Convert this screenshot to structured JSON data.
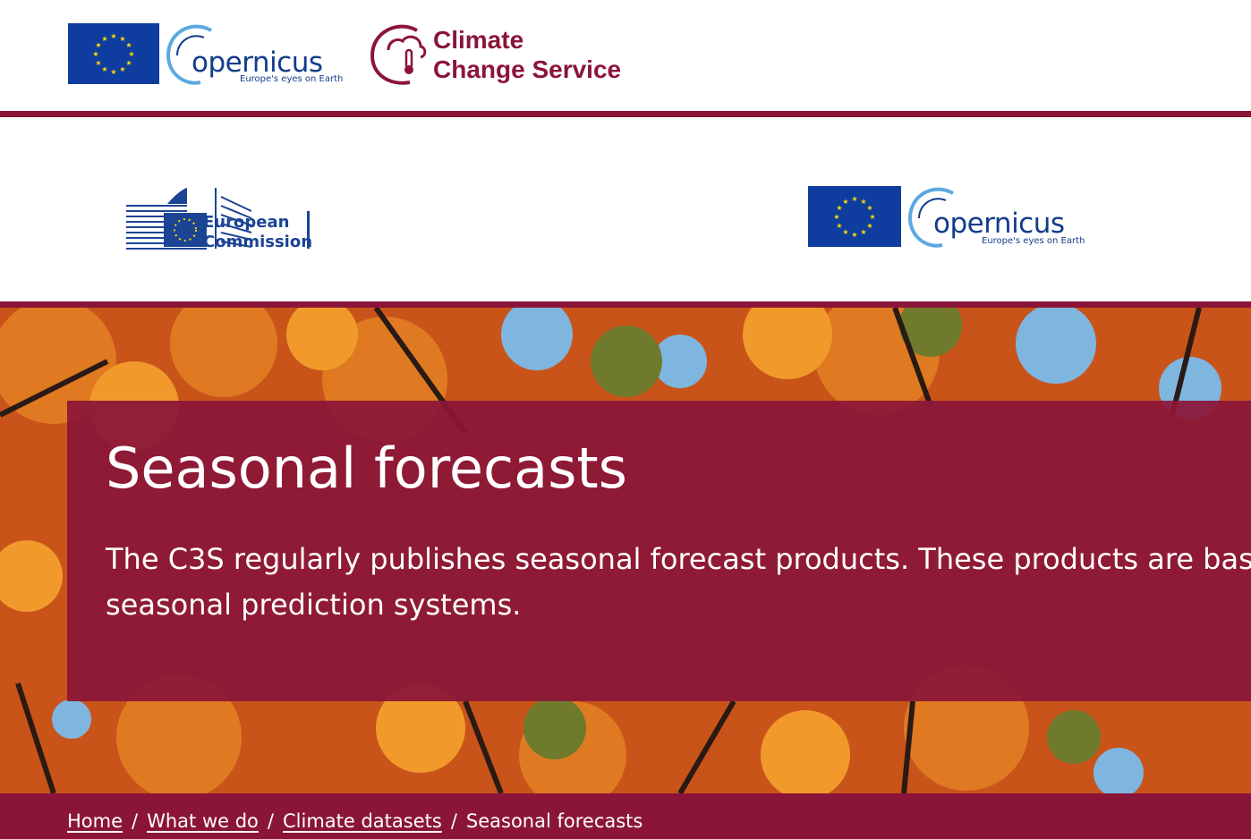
{
  "header": {
    "copernicus": {
      "wordmark": "opernicus",
      "initial": "C",
      "tagline": "Europe's eyes on Earth"
    },
    "service": {
      "line1": "Climate",
      "line2": "Change Service"
    }
  },
  "partners": {
    "european_commission": {
      "line1": "European",
      "line2": "Commission"
    },
    "copernicus": {
      "wordmark": "opernicus",
      "initial": "C",
      "tagline": "Europe's eyes on Earth"
    }
  },
  "hero": {
    "title": "Seasonal forecasts",
    "description": "The C3S regularly publishes seasonal forecast products. These products are based on seasonal prediction systems."
  },
  "breadcrumb": {
    "items": [
      "Home",
      "What we do",
      "Climate datasets"
    ],
    "current": "Seasonal forecasts"
  },
  "colors": {
    "brand": "#8b1538",
    "eu_blue": "#0f3d9f",
    "eu_star": "#ffdd00",
    "copernicus_blue": "#123c8c"
  },
  "icons": [
    "eu-flag-icon",
    "copernicus-swoosh-icon",
    "thermometer-cloud-icon",
    "european-commission-building-icon"
  ]
}
